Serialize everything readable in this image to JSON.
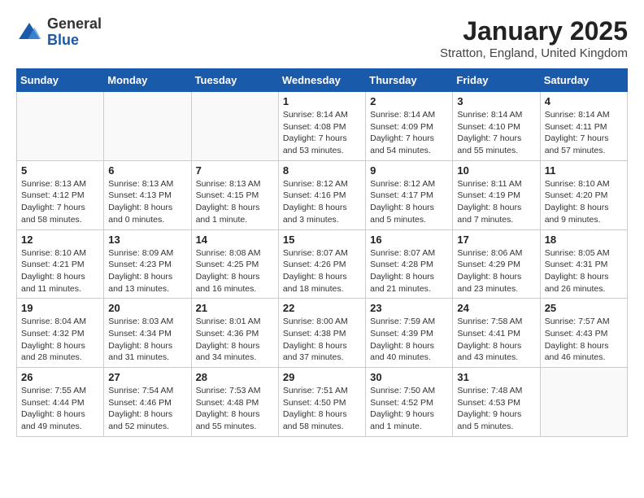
{
  "logo": {
    "general": "General",
    "blue": "Blue"
  },
  "header": {
    "month": "January 2025",
    "location": "Stratton, England, United Kingdom"
  },
  "weekdays": [
    "Sunday",
    "Monday",
    "Tuesday",
    "Wednesday",
    "Thursday",
    "Friday",
    "Saturday"
  ],
  "weeks": [
    [
      {
        "day": "",
        "info": ""
      },
      {
        "day": "",
        "info": ""
      },
      {
        "day": "",
        "info": ""
      },
      {
        "day": "1",
        "info": "Sunrise: 8:14 AM\nSunset: 4:08 PM\nDaylight: 7 hours\nand 53 minutes."
      },
      {
        "day": "2",
        "info": "Sunrise: 8:14 AM\nSunset: 4:09 PM\nDaylight: 7 hours\nand 54 minutes."
      },
      {
        "day": "3",
        "info": "Sunrise: 8:14 AM\nSunset: 4:10 PM\nDaylight: 7 hours\nand 55 minutes."
      },
      {
        "day": "4",
        "info": "Sunrise: 8:14 AM\nSunset: 4:11 PM\nDaylight: 7 hours\nand 57 minutes."
      }
    ],
    [
      {
        "day": "5",
        "info": "Sunrise: 8:13 AM\nSunset: 4:12 PM\nDaylight: 7 hours\nand 58 minutes."
      },
      {
        "day": "6",
        "info": "Sunrise: 8:13 AM\nSunset: 4:13 PM\nDaylight: 8 hours\nand 0 minutes."
      },
      {
        "day": "7",
        "info": "Sunrise: 8:13 AM\nSunset: 4:15 PM\nDaylight: 8 hours\nand 1 minute."
      },
      {
        "day": "8",
        "info": "Sunrise: 8:12 AM\nSunset: 4:16 PM\nDaylight: 8 hours\nand 3 minutes."
      },
      {
        "day": "9",
        "info": "Sunrise: 8:12 AM\nSunset: 4:17 PM\nDaylight: 8 hours\nand 5 minutes."
      },
      {
        "day": "10",
        "info": "Sunrise: 8:11 AM\nSunset: 4:19 PM\nDaylight: 8 hours\nand 7 minutes."
      },
      {
        "day": "11",
        "info": "Sunrise: 8:10 AM\nSunset: 4:20 PM\nDaylight: 8 hours\nand 9 minutes."
      }
    ],
    [
      {
        "day": "12",
        "info": "Sunrise: 8:10 AM\nSunset: 4:21 PM\nDaylight: 8 hours\nand 11 minutes."
      },
      {
        "day": "13",
        "info": "Sunrise: 8:09 AM\nSunset: 4:23 PM\nDaylight: 8 hours\nand 13 minutes."
      },
      {
        "day": "14",
        "info": "Sunrise: 8:08 AM\nSunset: 4:25 PM\nDaylight: 8 hours\nand 16 minutes."
      },
      {
        "day": "15",
        "info": "Sunrise: 8:07 AM\nSunset: 4:26 PM\nDaylight: 8 hours\nand 18 minutes."
      },
      {
        "day": "16",
        "info": "Sunrise: 8:07 AM\nSunset: 4:28 PM\nDaylight: 8 hours\nand 21 minutes."
      },
      {
        "day": "17",
        "info": "Sunrise: 8:06 AM\nSunset: 4:29 PM\nDaylight: 8 hours\nand 23 minutes."
      },
      {
        "day": "18",
        "info": "Sunrise: 8:05 AM\nSunset: 4:31 PM\nDaylight: 8 hours\nand 26 minutes."
      }
    ],
    [
      {
        "day": "19",
        "info": "Sunrise: 8:04 AM\nSunset: 4:32 PM\nDaylight: 8 hours\nand 28 minutes."
      },
      {
        "day": "20",
        "info": "Sunrise: 8:03 AM\nSunset: 4:34 PM\nDaylight: 8 hours\nand 31 minutes."
      },
      {
        "day": "21",
        "info": "Sunrise: 8:01 AM\nSunset: 4:36 PM\nDaylight: 8 hours\nand 34 minutes."
      },
      {
        "day": "22",
        "info": "Sunrise: 8:00 AM\nSunset: 4:38 PM\nDaylight: 8 hours\nand 37 minutes."
      },
      {
        "day": "23",
        "info": "Sunrise: 7:59 AM\nSunset: 4:39 PM\nDaylight: 8 hours\nand 40 minutes."
      },
      {
        "day": "24",
        "info": "Sunrise: 7:58 AM\nSunset: 4:41 PM\nDaylight: 8 hours\nand 43 minutes."
      },
      {
        "day": "25",
        "info": "Sunrise: 7:57 AM\nSunset: 4:43 PM\nDaylight: 8 hours\nand 46 minutes."
      }
    ],
    [
      {
        "day": "26",
        "info": "Sunrise: 7:55 AM\nSunset: 4:44 PM\nDaylight: 8 hours\nand 49 minutes."
      },
      {
        "day": "27",
        "info": "Sunrise: 7:54 AM\nSunset: 4:46 PM\nDaylight: 8 hours\nand 52 minutes."
      },
      {
        "day": "28",
        "info": "Sunrise: 7:53 AM\nSunset: 4:48 PM\nDaylight: 8 hours\nand 55 minutes."
      },
      {
        "day": "29",
        "info": "Sunrise: 7:51 AM\nSunset: 4:50 PM\nDaylight: 8 hours\nand 58 minutes."
      },
      {
        "day": "30",
        "info": "Sunrise: 7:50 AM\nSunset: 4:52 PM\nDaylight: 9 hours\nand 1 minute."
      },
      {
        "day": "31",
        "info": "Sunrise: 7:48 AM\nSunset: 4:53 PM\nDaylight: 9 hours\nand 5 minutes."
      },
      {
        "day": "",
        "info": ""
      }
    ]
  ]
}
